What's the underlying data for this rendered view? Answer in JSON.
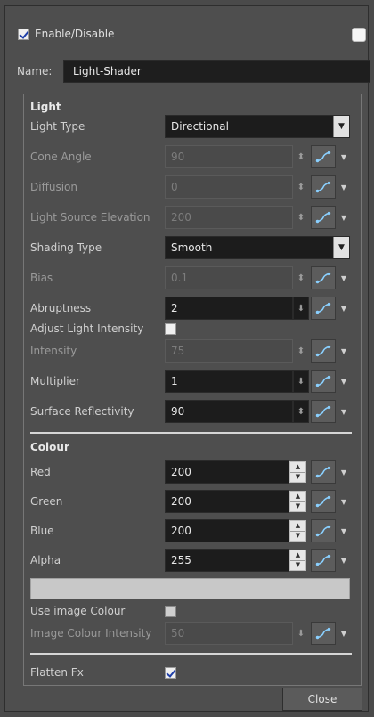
{
  "header": {
    "enable_label": "Enable/Disable",
    "enabled": true,
    "swatch_color": "#f5f5f5"
  },
  "name": {
    "label": "Name:",
    "value": "Light-Shader"
  },
  "light": {
    "section_title": "Light",
    "light_type": {
      "label": "Light Type",
      "value": "Directional"
    },
    "cone_angle": {
      "label": "Cone Angle",
      "value": "90"
    },
    "diffusion": {
      "label": "Diffusion",
      "value": "0"
    },
    "elevation": {
      "label": "Light Source Elevation",
      "value": "200"
    },
    "shading_type": {
      "label": "Shading Type",
      "value": "Smooth"
    },
    "bias": {
      "label": "Bias",
      "value": "0.1"
    },
    "abruptness": {
      "label": "Abruptness",
      "value": "2"
    },
    "adjust_intensity": {
      "label": "Adjust Light Intensity",
      "checked": false
    },
    "intensity": {
      "label": "Intensity",
      "value": "75"
    },
    "multiplier": {
      "label": "Multiplier",
      "value": "1"
    },
    "surface_reflectivity": {
      "label": "Surface Reflectivity",
      "value": "90"
    }
  },
  "colour": {
    "section_title": "Colour",
    "red": {
      "label": "Red",
      "value": "200"
    },
    "green": {
      "label": "Green",
      "value": "200"
    },
    "blue": {
      "label": "Blue",
      "value": "200"
    },
    "alpha": {
      "label": "Alpha",
      "value": "255"
    },
    "preview_color": "#c8c8c8",
    "use_image_colour": {
      "label": "Use image Colour",
      "checked": false
    },
    "image_colour_intensity": {
      "label": "Image Colour Intensity",
      "value": "50"
    }
  },
  "flatten": {
    "label": "Flatten Fx",
    "checked": true
  },
  "footer": {
    "close_label": "Close"
  },
  "icons": {
    "function": "function-curve-icon",
    "arrow": "chevron-down-icon",
    "spin": "spin-arrows-icon"
  }
}
